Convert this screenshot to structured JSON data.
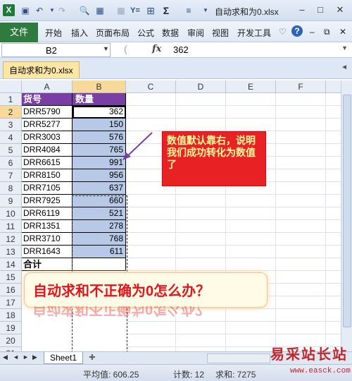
{
  "window": {
    "title": "自动求和为0.xlsx",
    "logo": "X"
  },
  "quick_access": {
    "icons": [
      "save-icon",
      "undo-icon",
      "redo-icon",
      "print-preview-icon",
      "format-icon",
      "calc-icon",
      "filter-icon",
      "border-icon",
      "sum-icon",
      "align-icon",
      "customize-icon"
    ],
    "sigma": "Σ",
    "filter_text": "Y=",
    "border_glyph": "⊞"
  },
  "ribbon": {
    "file_label": "文件",
    "tabs": [
      "开始",
      "插入",
      "页面布局",
      "公式",
      "数据",
      "审阅",
      "视图",
      "开发工具"
    ]
  },
  "formula_bar": {
    "name_box": "B2",
    "fx": "fx",
    "value": "362"
  },
  "workbook_tab": "自动求和为0.xlsx",
  "columns": [
    "A",
    "B",
    "C",
    "D",
    "E",
    "F"
  ],
  "rows": [
    "1",
    "2",
    "3",
    "4",
    "5",
    "6",
    "7",
    "8",
    "9",
    "10",
    "11",
    "12",
    "13",
    "14",
    "15",
    "16",
    "17",
    "18",
    "19",
    "20",
    "21"
  ],
  "table": {
    "header_a": "货号",
    "header_b": "数量",
    "items": [
      {
        "code": "DRR5790",
        "qty": "362"
      },
      {
        "code": "DRR5277",
        "qty": "150"
      },
      {
        "code": "DRR3003",
        "qty": "576"
      },
      {
        "code": "DRR4084",
        "qty": "765"
      },
      {
        "code": "DRR6615",
        "qty": "991"
      },
      {
        "code": "DRR8150",
        "qty": "956"
      },
      {
        "code": "DRR7105",
        "qty": "637"
      },
      {
        "code": "DRR7925",
        "qty": "660"
      },
      {
        "code": "DRR6119",
        "qty": "521"
      },
      {
        "code": "DRR1351",
        "qty": "278"
      },
      {
        "code": "DRR3710",
        "qty": "768"
      },
      {
        "code": "DRR1643",
        "qty": "611"
      }
    ],
    "total_label": "合计"
  },
  "callout": {
    "text": "数值默认靠右，说明我们成功转化为数值了",
    "color": "#e82125",
    "text_color": "#fffb9a"
  },
  "banner": {
    "text": "自动求和不正确为0怎么办？",
    "color": "#e3141b"
  },
  "sheet_tabs": {
    "active": "Sheet1"
  },
  "status_bar": {
    "average": "平均值: 606.25",
    "count": "计数: 12",
    "sum": "求和: 7275"
  },
  "watermark": {
    "logo": "易采站长站",
    "url": "www.easck.com"
  }
}
